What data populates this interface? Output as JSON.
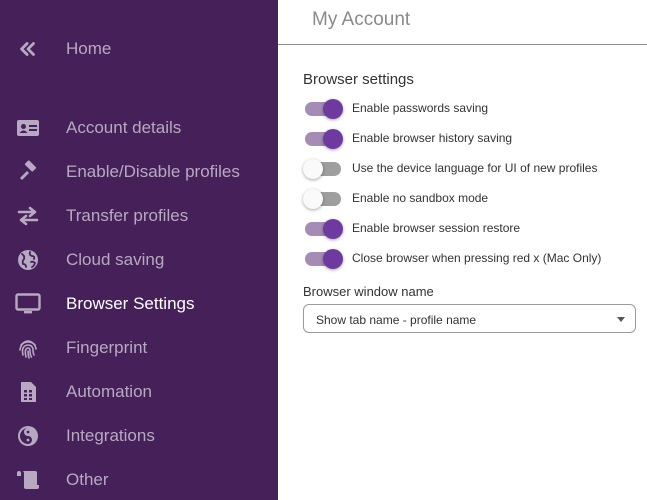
{
  "sidebar": {
    "items": [
      {
        "label": "Home",
        "icon": "double-chevron-left-icon"
      },
      {
        "label": "Account details",
        "icon": "id-card-icon"
      },
      {
        "label": "Enable/Disable profiles",
        "icon": "gavel-icon"
      },
      {
        "label": "Transfer profiles",
        "icon": "swap-arrows-icon"
      },
      {
        "label": "Cloud saving",
        "icon": "globe-icon"
      },
      {
        "label": "Browser Settings",
        "icon": "monitor-icon",
        "active": true
      },
      {
        "label": "Fingerprint",
        "icon": "fingerprint-icon"
      },
      {
        "label": "Automation",
        "icon": "sim-card-icon"
      },
      {
        "label": "Integrations",
        "icon": "yin-yang-icon"
      },
      {
        "label": "Other",
        "icon": "scroll-icon"
      }
    ],
    "colors": {
      "background": "#462159",
      "text": "#b7a9c1",
      "active_text": "#ffffff"
    }
  },
  "main": {
    "title": "My Account",
    "section_title": "Browser settings",
    "toggles": [
      {
        "label": "Enable passwords saving",
        "on": true
      },
      {
        "label": "Enable browser history saving",
        "on": true
      },
      {
        "label": "Use the device language for UI of new profiles",
        "on": false
      },
      {
        "label": "Enable no sandbox mode",
        "on": false
      },
      {
        "label": "Enable browser session restore",
        "on": true
      },
      {
        "label": "Close browser when pressing red x (Mac Only)",
        "on": true
      }
    ],
    "window_name": {
      "label": "Browser window name",
      "selected": "Show tab name - profile name"
    },
    "colors": {
      "accent": "#6e3aa0"
    }
  }
}
